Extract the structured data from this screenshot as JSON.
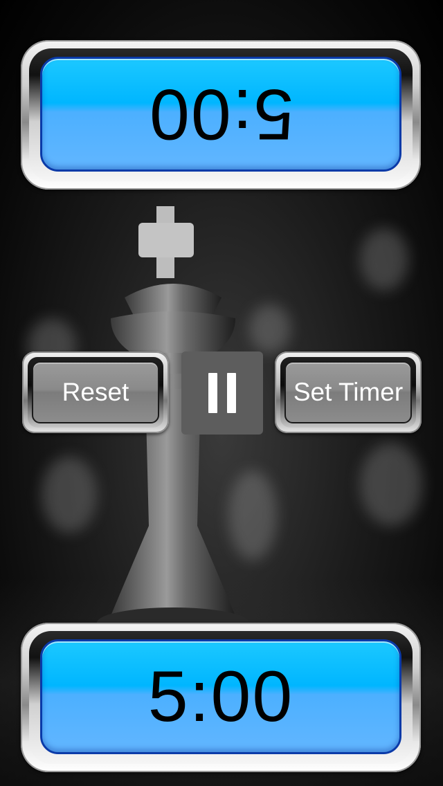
{
  "top_timer": {
    "time": "5:00"
  },
  "bottom_timer": {
    "time": "5:00"
  },
  "controls": {
    "reset_label": "Reset",
    "set_timer_label": "Set Timer",
    "pause_icon": "pause-icon"
  },
  "colors": {
    "timer_face": "#00b6ff",
    "timer_border": "#0a3aa8",
    "control_gray": "#8a8a8a",
    "pause_gray": "#5d5d5d"
  },
  "background": {
    "image": "chess-king-piece"
  }
}
